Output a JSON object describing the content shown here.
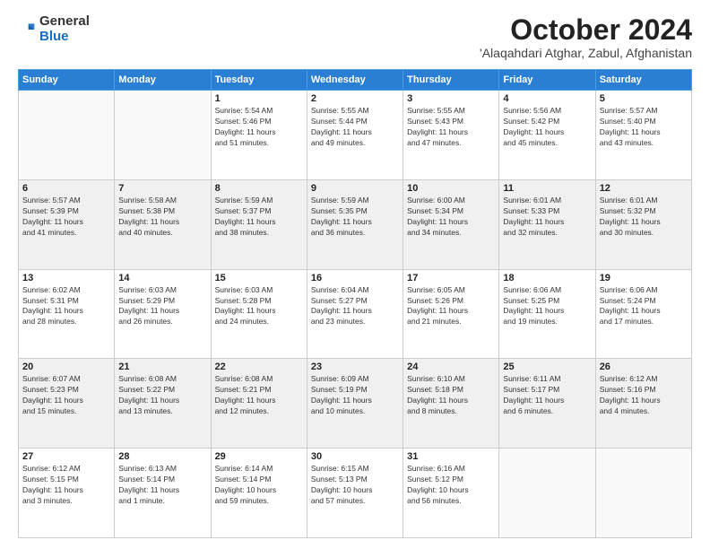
{
  "logo": {
    "text_general": "General",
    "text_blue": "Blue"
  },
  "header": {
    "month": "October 2024",
    "location": "'Alaqahdari Atghar, Zabul, Afghanistan"
  },
  "weekdays": [
    "Sunday",
    "Monday",
    "Tuesday",
    "Wednesday",
    "Thursday",
    "Friday",
    "Saturday"
  ],
  "weeks": [
    [
      {
        "day": "",
        "info": ""
      },
      {
        "day": "",
        "info": ""
      },
      {
        "day": "1",
        "info": "Sunrise: 5:54 AM\nSunset: 5:46 PM\nDaylight: 11 hours\nand 51 minutes."
      },
      {
        "day": "2",
        "info": "Sunrise: 5:55 AM\nSunset: 5:44 PM\nDaylight: 11 hours\nand 49 minutes."
      },
      {
        "day": "3",
        "info": "Sunrise: 5:55 AM\nSunset: 5:43 PM\nDaylight: 11 hours\nand 47 minutes."
      },
      {
        "day": "4",
        "info": "Sunrise: 5:56 AM\nSunset: 5:42 PM\nDaylight: 11 hours\nand 45 minutes."
      },
      {
        "day": "5",
        "info": "Sunrise: 5:57 AM\nSunset: 5:40 PM\nDaylight: 11 hours\nand 43 minutes."
      }
    ],
    [
      {
        "day": "6",
        "info": "Sunrise: 5:57 AM\nSunset: 5:39 PM\nDaylight: 11 hours\nand 41 minutes."
      },
      {
        "day": "7",
        "info": "Sunrise: 5:58 AM\nSunset: 5:38 PM\nDaylight: 11 hours\nand 40 minutes."
      },
      {
        "day": "8",
        "info": "Sunrise: 5:59 AM\nSunset: 5:37 PM\nDaylight: 11 hours\nand 38 minutes."
      },
      {
        "day": "9",
        "info": "Sunrise: 5:59 AM\nSunset: 5:35 PM\nDaylight: 11 hours\nand 36 minutes."
      },
      {
        "day": "10",
        "info": "Sunrise: 6:00 AM\nSunset: 5:34 PM\nDaylight: 11 hours\nand 34 minutes."
      },
      {
        "day": "11",
        "info": "Sunrise: 6:01 AM\nSunset: 5:33 PM\nDaylight: 11 hours\nand 32 minutes."
      },
      {
        "day": "12",
        "info": "Sunrise: 6:01 AM\nSunset: 5:32 PM\nDaylight: 11 hours\nand 30 minutes."
      }
    ],
    [
      {
        "day": "13",
        "info": "Sunrise: 6:02 AM\nSunset: 5:31 PM\nDaylight: 11 hours\nand 28 minutes."
      },
      {
        "day": "14",
        "info": "Sunrise: 6:03 AM\nSunset: 5:29 PM\nDaylight: 11 hours\nand 26 minutes."
      },
      {
        "day": "15",
        "info": "Sunrise: 6:03 AM\nSunset: 5:28 PM\nDaylight: 11 hours\nand 24 minutes."
      },
      {
        "day": "16",
        "info": "Sunrise: 6:04 AM\nSunset: 5:27 PM\nDaylight: 11 hours\nand 23 minutes."
      },
      {
        "day": "17",
        "info": "Sunrise: 6:05 AM\nSunset: 5:26 PM\nDaylight: 11 hours\nand 21 minutes."
      },
      {
        "day": "18",
        "info": "Sunrise: 6:06 AM\nSunset: 5:25 PM\nDaylight: 11 hours\nand 19 minutes."
      },
      {
        "day": "19",
        "info": "Sunrise: 6:06 AM\nSunset: 5:24 PM\nDaylight: 11 hours\nand 17 minutes."
      }
    ],
    [
      {
        "day": "20",
        "info": "Sunrise: 6:07 AM\nSunset: 5:23 PM\nDaylight: 11 hours\nand 15 minutes."
      },
      {
        "day": "21",
        "info": "Sunrise: 6:08 AM\nSunset: 5:22 PM\nDaylight: 11 hours\nand 13 minutes."
      },
      {
        "day": "22",
        "info": "Sunrise: 6:08 AM\nSunset: 5:21 PM\nDaylight: 11 hours\nand 12 minutes."
      },
      {
        "day": "23",
        "info": "Sunrise: 6:09 AM\nSunset: 5:19 PM\nDaylight: 11 hours\nand 10 minutes."
      },
      {
        "day": "24",
        "info": "Sunrise: 6:10 AM\nSunset: 5:18 PM\nDaylight: 11 hours\nand 8 minutes."
      },
      {
        "day": "25",
        "info": "Sunrise: 6:11 AM\nSunset: 5:17 PM\nDaylight: 11 hours\nand 6 minutes."
      },
      {
        "day": "26",
        "info": "Sunrise: 6:12 AM\nSunset: 5:16 PM\nDaylight: 11 hours\nand 4 minutes."
      }
    ],
    [
      {
        "day": "27",
        "info": "Sunrise: 6:12 AM\nSunset: 5:15 PM\nDaylight: 11 hours\nand 3 minutes."
      },
      {
        "day": "28",
        "info": "Sunrise: 6:13 AM\nSunset: 5:14 PM\nDaylight: 11 hours\nand 1 minute."
      },
      {
        "day": "29",
        "info": "Sunrise: 6:14 AM\nSunset: 5:14 PM\nDaylight: 10 hours\nand 59 minutes."
      },
      {
        "day": "30",
        "info": "Sunrise: 6:15 AM\nSunset: 5:13 PM\nDaylight: 10 hours\nand 57 minutes."
      },
      {
        "day": "31",
        "info": "Sunrise: 6:16 AM\nSunset: 5:12 PM\nDaylight: 10 hours\nand 56 minutes."
      },
      {
        "day": "",
        "info": ""
      },
      {
        "day": "",
        "info": ""
      }
    ]
  ]
}
